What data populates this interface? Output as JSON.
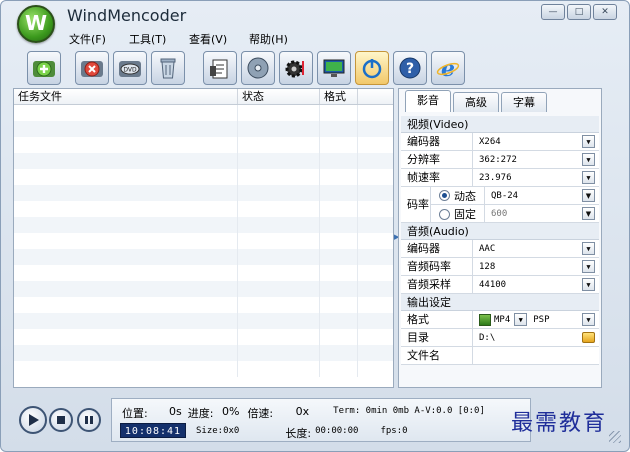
{
  "app": {
    "title": "WindMencoder",
    "logo_letter": "W"
  },
  "window_controls": {
    "minimize": "—",
    "maximize": "□",
    "close": "✕"
  },
  "menu": [
    "文件(F)",
    "工具(T)",
    "查看(V)",
    "帮助(H)"
  ],
  "toolbar": {
    "buttons": [
      {
        "name": "add-file",
        "icon": "add-icon"
      },
      {
        "name": "remove",
        "icon": "remove-icon"
      },
      {
        "name": "dvd",
        "icon": "dvd-icon"
      },
      {
        "name": "clear",
        "icon": "trash-icon"
      },
      {
        "name": "task-list",
        "icon": "clipboard-icon"
      },
      {
        "name": "disc",
        "icon": "disc-icon"
      },
      {
        "name": "settings",
        "icon": "gear-icon"
      },
      {
        "name": "preview",
        "icon": "monitor-icon"
      },
      {
        "name": "power",
        "icon": "power-icon"
      },
      {
        "name": "help",
        "icon": "help-icon"
      },
      {
        "name": "web",
        "icon": "browser-icon"
      }
    ]
  },
  "tasklist": {
    "columns": [
      "任务文件",
      "状态",
      "格式"
    ],
    "row_count": 17
  },
  "panel": {
    "tabs": [
      "影音",
      "高级",
      "字幕"
    ],
    "video_section": "视频(Video)",
    "video": {
      "encoder_label": "编码器",
      "encoder_value": "X264",
      "resolution_label": "分辨率",
      "resolution_value": "362:272",
      "fps_label": "帧速率",
      "fps_value": "23.976",
      "bitrate_label": "码率",
      "dynamic_label": "动态",
      "dynamic_value": "QB-24",
      "fixed_label": "固定",
      "fixed_value": "600"
    },
    "audio_section": "音频(Audio)",
    "audio": {
      "encoder_label": "编码器",
      "encoder_value": "AAC",
      "bitrate_label": "音频码率",
      "bitrate_value": "128",
      "sample_label": "音频采样",
      "sample_value": "44100"
    },
    "output_section": "输出设定",
    "output": {
      "format_label": "格式",
      "format_value": "MP4",
      "profile_value": "PSP",
      "dir_label": "目录",
      "dir_value": "D:\\",
      "filename_label": "文件名",
      "filename_value": ""
    }
  },
  "status": {
    "position_label": "位置:",
    "position_value": "0s",
    "progress_label": "进度:",
    "progress_value": "0%",
    "speed_label": "倍速:",
    "speed_value": "0x",
    "term_text": "Term: 0min 0mb A-V:0.0 [0:0]",
    "timer": "10:08:41",
    "size_text": "Size:0x0",
    "length_label": "长度:",
    "length_value": "00:00:00",
    "fps_text": "fps:0"
  },
  "watermark": "最需教育",
  "colors": {
    "accent": "#14306b",
    "window_bg": "#dbe4ee"
  }
}
